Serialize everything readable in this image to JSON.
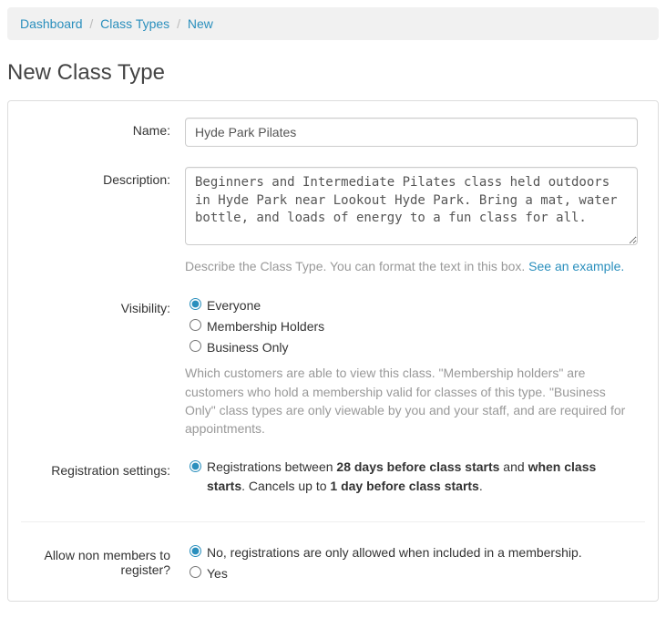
{
  "breadcrumb": {
    "items": [
      "Dashboard",
      "Class Types",
      "New"
    ]
  },
  "pageTitle": "New Class Type",
  "form": {
    "name": {
      "label": "Name:",
      "value": "Hyde Park Pilates"
    },
    "description": {
      "label": "Description:",
      "value": "Beginners and Intermediate Pilates class held outdoors in Hyde Park near Lookout Hyde Park. Bring a mat, water bottle, and loads of energy to a fun class for all.",
      "help_prefix": "Describe the Class Type. You can format the text in this box. ",
      "help_link": "See an example."
    },
    "visibility": {
      "label": "Visibility:",
      "options": [
        "Everyone",
        "Membership Holders",
        "Business Only"
      ],
      "selected": "Everyone",
      "help": "Which customers are able to view this class. \"Membership holders\" are customers who hold a membership valid for classes of this type. \"Business Only\" class types are only viewable by you and your staff, and are required for appointments."
    },
    "registration": {
      "label": "Registration settings:",
      "parts": {
        "p1": "Registrations between ",
        "b1": "28 days before class starts",
        "p2": " and ",
        "b2": "when class starts",
        "p3": ". Cancels up to ",
        "b3": "1 day before class starts",
        "p4": "."
      }
    },
    "nonmembers": {
      "label": "Allow non members to register?",
      "options": [
        "No, registrations are only allowed when included in a membership.",
        "Yes"
      ],
      "selected": "No, registrations are only allowed when included in a membership."
    }
  }
}
